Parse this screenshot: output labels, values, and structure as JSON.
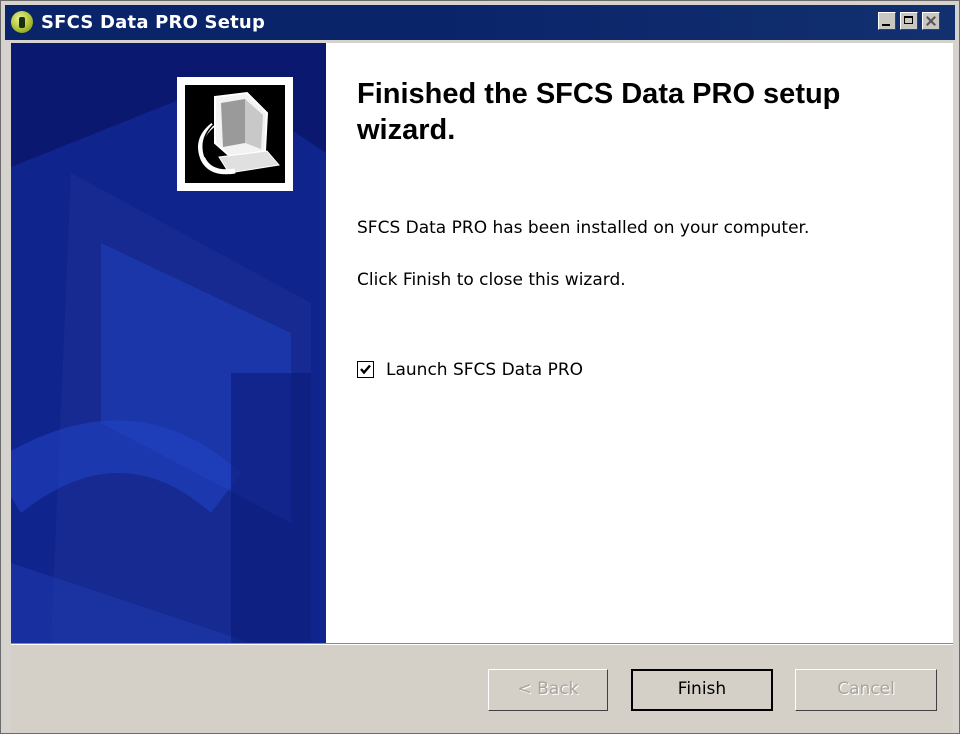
{
  "window": {
    "title": "SFCS Data PRO Setup",
    "app_icon": "sfcs-app-icon",
    "controls": [
      "minimize-icon",
      "maximize-icon",
      "close-icon"
    ]
  },
  "wizard": {
    "heading": "Finished the SFCS Data PRO setup wizard.",
    "message": "SFCS Data PRO has been installed on your computer.",
    "instruction": "Click Finish to close this wizard.",
    "launch_checkbox": {
      "label": "Launch SFCS Data PRO",
      "checked": true
    }
  },
  "buttons": {
    "back": "< Back",
    "finish": "Finish",
    "cancel": "Cancel"
  },
  "colors": {
    "titlebar": "#0a246a",
    "banner": "#0a1870",
    "dialog_face": "#d4d0c8"
  }
}
